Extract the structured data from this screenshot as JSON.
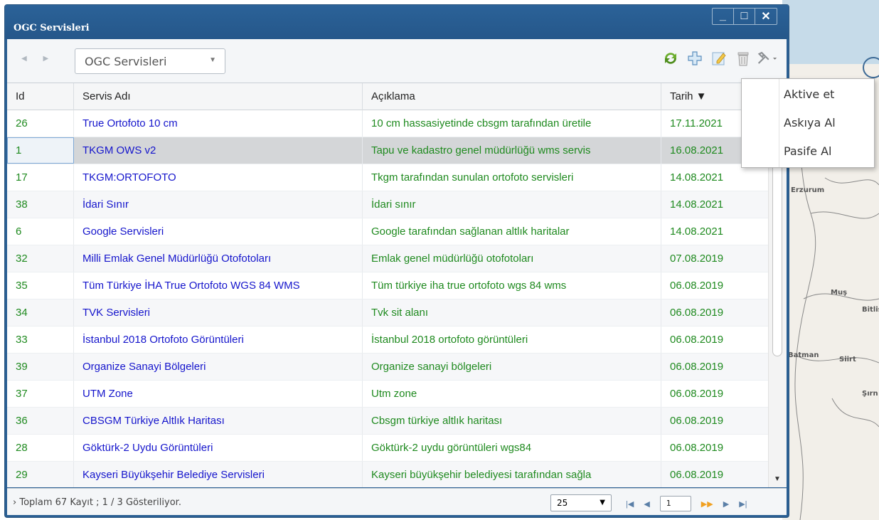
{
  "window": {
    "title": "OGC Servisleri",
    "buttons": {
      "minimize": "_",
      "maximize": "□",
      "close": "✕"
    }
  },
  "toolbar": {
    "nav_arrows": "◀ ▶",
    "combo_value": "OGC Servisleri",
    "combo_arrow": "▼",
    "icons": [
      "refresh-icon",
      "add-icon",
      "edit-icon",
      "delete-icon",
      "tools-icon"
    ]
  },
  "grid": {
    "columns": [
      "Id",
      "Servis Adı",
      "Açıklama",
      "Tarih ▼"
    ],
    "rows": [
      {
        "id": "26",
        "name": "True Ortofoto 10 cm",
        "desc": "10 cm hassasiyetinde cbsgm tarafından üretile",
        "date": "17.11.2021"
      },
      {
        "id": "1",
        "name": "TKGM OWS v2",
        "desc": "Tapu ve kadastro genel müdürlüğü wms servis",
        "date": "16.08.2021"
      },
      {
        "id": "17",
        "name": "TKGM:ORTOFOTO",
        "desc": "Tkgm tarafından sunulan ortofoto servisleri",
        "date": "14.08.2021"
      },
      {
        "id": "38",
        "name": "İdari Sınır",
        "desc": "İdari sınır",
        "date": "14.08.2021"
      },
      {
        "id": "6",
        "name": "Google Servisleri",
        "desc": "Google tarafından sağlanan altlık haritalar",
        "date": "14.08.2021"
      },
      {
        "id": "32",
        "name": "Milli Emlak Genel Müdürlüğü Otofotoları",
        "desc": "Emlak genel müdürlüğü otofotoları",
        "date": "07.08.2019"
      },
      {
        "id": "35",
        "name": "Tüm Türkiye İHA True Ortofoto WGS 84 WMS",
        "desc": "Tüm türkiye iha true ortofoto wgs 84 wms",
        "date": "06.08.2019"
      },
      {
        "id": "34",
        "name": "TVK Servisleri",
        "desc": "Tvk sit alanı",
        "date": "06.08.2019"
      },
      {
        "id": "33",
        "name": "İstanbul 2018 Ortofoto Görüntüleri",
        "desc": "İstanbul 2018 ortofoto görüntüleri",
        "date": "06.08.2019"
      },
      {
        "id": "39",
        "name": "Organize Sanayi Bölgeleri",
        "desc": "Organize sanayi bölgeleri",
        "date": "06.08.2019"
      },
      {
        "id": "37",
        "name": "UTM Zone",
        "desc": "Utm zone",
        "date": "06.08.2019"
      },
      {
        "id": "36",
        "name": "CBSGM Türkiye Altlık Haritası",
        "desc": "Cbsgm türkiye altlık haritası",
        "date": "06.08.2019"
      },
      {
        "id": "28",
        "name": "Göktürk-2 Uydu Görüntüleri",
        "desc": "Göktürk-2 uydu görüntüleri wgs84",
        "date": "06.08.2019"
      },
      {
        "id": "29",
        "name": "Kayseri Büyükşehir Belediye Servisleri",
        "desc": "Kayseri büyükşehir belediyesi tarafından sağla",
        "date": "06.08.2019"
      }
    ]
  },
  "footer": {
    "summary": "› Toplam 67 Kayıt ; 1 / 3 Gösteriliyor.",
    "page_size": "25",
    "page_number": "1"
  },
  "menu": {
    "items": [
      "Aktive et",
      "Askıya Al",
      "Pasife Al"
    ]
  },
  "map": {
    "labels": [
      "Erzurum",
      "Muş",
      "Bitlis",
      "Batman",
      "Siirt",
      "Şırn"
    ]
  },
  "colors": {
    "title_bar": "#2a5f93",
    "id_text": "#1f8a1f",
    "name_text": "#1515cc",
    "selected_row": "#d4d6d8"
  }
}
